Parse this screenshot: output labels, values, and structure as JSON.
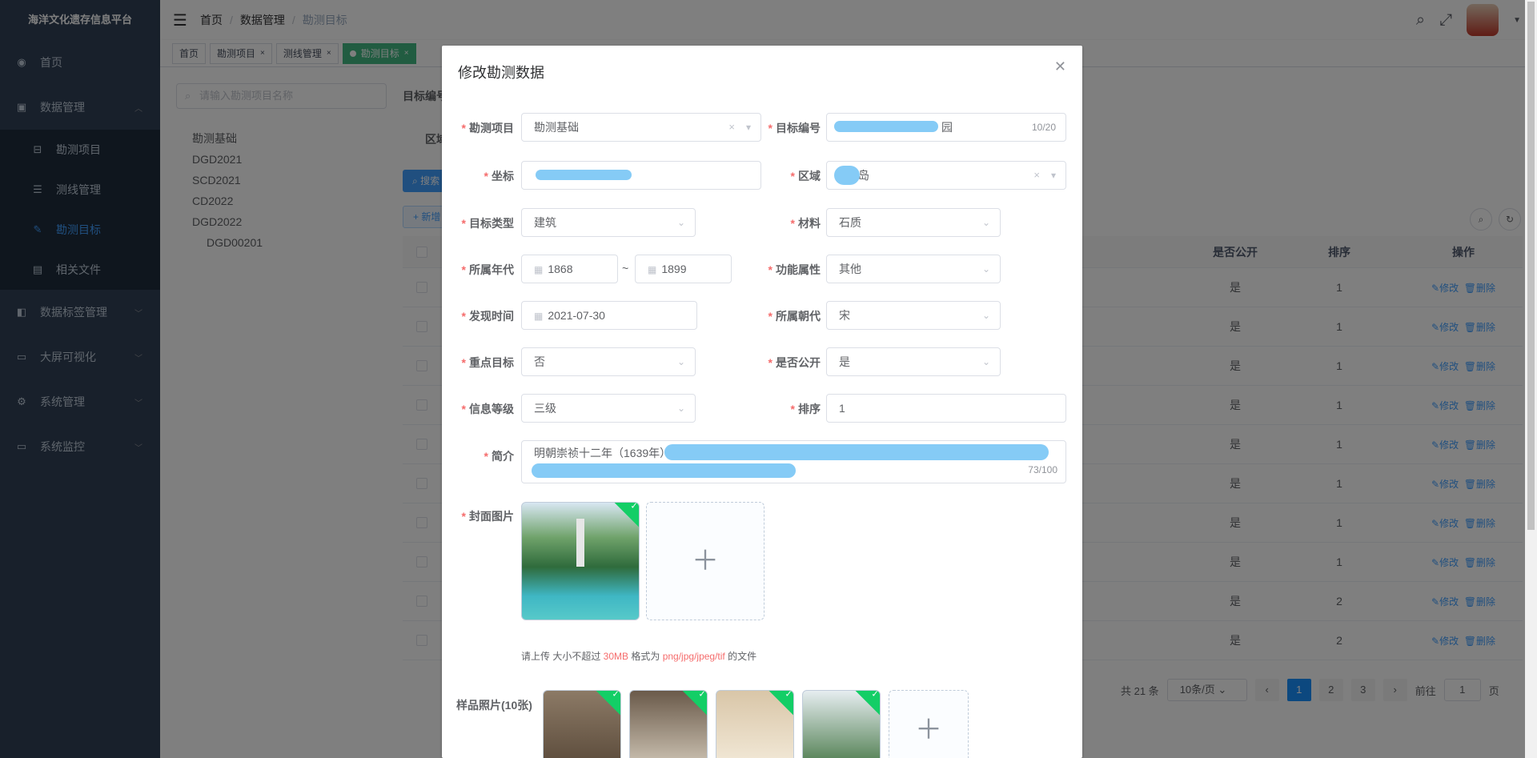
{
  "app": {
    "title": "海洋文化遗存信息平台"
  },
  "sidebar": {
    "items": [
      {
        "label": "首页",
        "icon": "dashboard-icon"
      },
      {
        "label": "数据管理",
        "icon": "database-icon"
      },
      {
        "label": "数据标签管理",
        "icon": "tag-icon"
      },
      {
        "label": "大屏可视化",
        "icon": "monitor-icon"
      },
      {
        "label": "系统管理",
        "icon": "gear-icon"
      },
      {
        "label": "系统监控",
        "icon": "monitor-icon"
      }
    ],
    "sub_items": [
      {
        "label": "勘测项目",
        "icon": "project-icon"
      },
      {
        "label": "测线管理",
        "icon": "list-icon"
      },
      {
        "label": "勘测目标",
        "icon": "edit-icon",
        "active": true
      },
      {
        "label": "相关文件",
        "icon": "file-icon"
      }
    ]
  },
  "navbar": {
    "breadcrumb": [
      "首页",
      "数据管理",
      "勘测目标"
    ]
  },
  "tags": [
    "首页",
    "勘测项目",
    "测线管理",
    "勘测目标"
  ],
  "background": {
    "tree_search_placeholder": "请输入勘测项目名称",
    "tree": [
      "勘测基础",
      "DGD2021",
      "SCD2021",
      "CD2022",
      "DGD2022",
      "DGD00201"
    ],
    "label_target_no": "目标编号",
    "label_area": "区域",
    "btn_search": "搜索",
    "btn_add": "新增",
    "table": {
      "headers": {
        "public": "是否公开",
        "sort": "排序",
        "op": "操作"
      },
      "rows": [
        {
          "public": "是",
          "sort": "1"
        },
        {
          "public": "是",
          "sort": "1"
        },
        {
          "public": "是",
          "sort": "1"
        },
        {
          "public": "是",
          "sort": "1"
        },
        {
          "public": "是",
          "sort": "1"
        },
        {
          "public": "是",
          "sort": "1"
        },
        {
          "public": "是",
          "sort": "1"
        },
        {
          "public": "是",
          "sort": "1"
        },
        {
          "public": "是",
          "sort": "2"
        },
        {
          "public": "是",
          "sort": "2"
        }
      ],
      "edit_label": "修改",
      "delete_label": "删除"
    },
    "pagination": {
      "total": "共 21 条",
      "page_size": "10条/页",
      "pages": [
        "1",
        "2",
        "3"
      ],
      "current": 1,
      "goto_label": "前往",
      "goto_value": "1",
      "page_unit": "页"
    }
  },
  "dialog": {
    "title": "修改勘测数据",
    "fields": {
      "project": {
        "label": "勘测项目",
        "value": "勘测基础"
      },
      "target_no": {
        "label": "目标编号",
        "value": "园",
        "count": "10/20"
      },
      "coord": {
        "label": "坐标",
        "value": ""
      },
      "area": {
        "label": "区域",
        "value": "岛"
      },
      "target_type": {
        "label": "目标类型",
        "value": "建筑"
      },
      "material": {
        "label": "材料",
        "value": "石质"
      },
      "era": {
        "label": "所属年代",
        "from": "1868",
        "to": "1899",
        "sep": "~"
      },
      "function": {
        "label": "功能属性",
        "value": "其他"
      },
      "found_time": {
        "label": "发现时间",
        "value": "2021-07-30"
      },
      "dynasty": {
        "label": "所属朝代",
        "value": "宋"
      },
      "key_target": {
        "label": "重点目标",
        "value": "否"
      },
      "is_public": {
        "label": "是否公开",
        "value": "是"
      },
      "info_level": {
        "label": "信息等级",
        "value": "三级"
      },
      "sort": {
        "label": "排序",
        "value": "1"
      },
      "intro": {
        "label": "简介",
        "value": "明朝崇祯十二年（1639年）",
        "count": "73/100"
      },
      "cover": {
        "label": "封面图片"
      },
      "samples": {
        "label": "样品照片(10张)"
      }
    },
    "hint": {
      "prefix": "请上传 大小不超过 ",
      "size": "30MB",
      "middle": " 格式为 ",
      "formats": "png/jpg/jpeg/tif",
      "suffix": " 的文件"
    }
  }
}
